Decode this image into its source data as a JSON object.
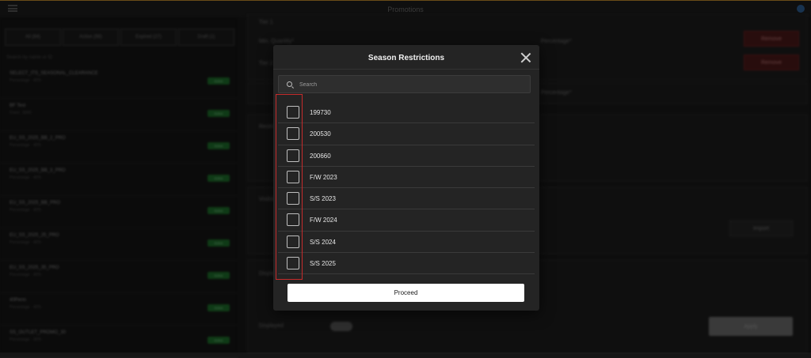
{
  "app": {
    "title": "Promotions"
  },
  "background": {
    "tabs": [
      "All (84)",
      "Active (56)",
      "Expired (27)",
      "Draft (1)"
    ],
    "list_search_placeholder": "Search by name or ID",
    "promotions": [
      {
        "title": "SELECT_ITS_SEASONAL_CLEARANCE",
        "sub": "Percentage · 40%",
        "status": "Active"
      },
      {
        "title": "BF Test",
        "sub": "Fixed · $300",
        "status": "Active"
      },
      {
        "title": "EU_SS_2025_BB_2_PRO",
        "sub": "Percentage · 40%",
        "status": "Active"
      },
      {
        "title": "EU_SS_2025_BB_3_PRO",
        "sub": "Percentage · 40%",
        "status": "Active"
      },
      {
        "title": "EU_SS_2025_BB_PRO",
        "sub": "Percentage · 40%",
        "status": "Active"
      },
      {
        "title": "EU_SS_2025_25_PRO",
        "sub": "Percentage · 40%",
        "status": "Active"
      },
      {
        "title": "EU_SS_2025_35_PRO",
        "sub": "Percentage · 40%",
        "status": "Active"
      },
      {
        "title": "40Perm",
        "sub": "Percentage · 40%",
        "status": "Active"
      },
      {
        "title": "SS_OUTLET_PROMO_30",
        "sub": "Percentage · 30%",
        "status": "Active"
      }
    ],
    "right": {
      "tier1_label": "Tier 1",
      "min_qty_label": "Min. Quantity*",
      "percentage_label": "Percentage*",
      "tier2_label": "Tier 2",
      "remove_label": "Remove",
      "restrictions_label": "Restrictions",
      "visibility_label": "Visibility",
      "import_label": "Import",
      "display_label": "Display",
      "displayed_label": "Displayed",
      "apply_label": "Apply"
    }
  },
  "modal": {
    "title": "Season Restrictions",
    "search_placeholder": "Search",
    "seasons": [
      {
        "label": "199730",
        "checked": false
      },
      {
        "label": "200530",
        "checked": false
      },
      {
        "label": "200660",
        "checked": false
      },
      {
        "label": "F/W 2023",
        "checked": false
      },
      {
        "label": "S/S 2023",
        "checked": false
      },
      {
        "label": "F/W 2024",
        "checked": false
      },
      {
        "label": "S/S 2024",
        "checked": false
      },
      {
        "label": "S/S 2025",
        "checked": false
      }
    ],
    "proceed_label": "Proceed"
  },
  "colors": {
    "highlight": "#c52b2b",
    "badge_active": "#1d6b2a",
    "remove_button": "#4a1818",
    "accent_top": "#c28a2c"
  }
}
